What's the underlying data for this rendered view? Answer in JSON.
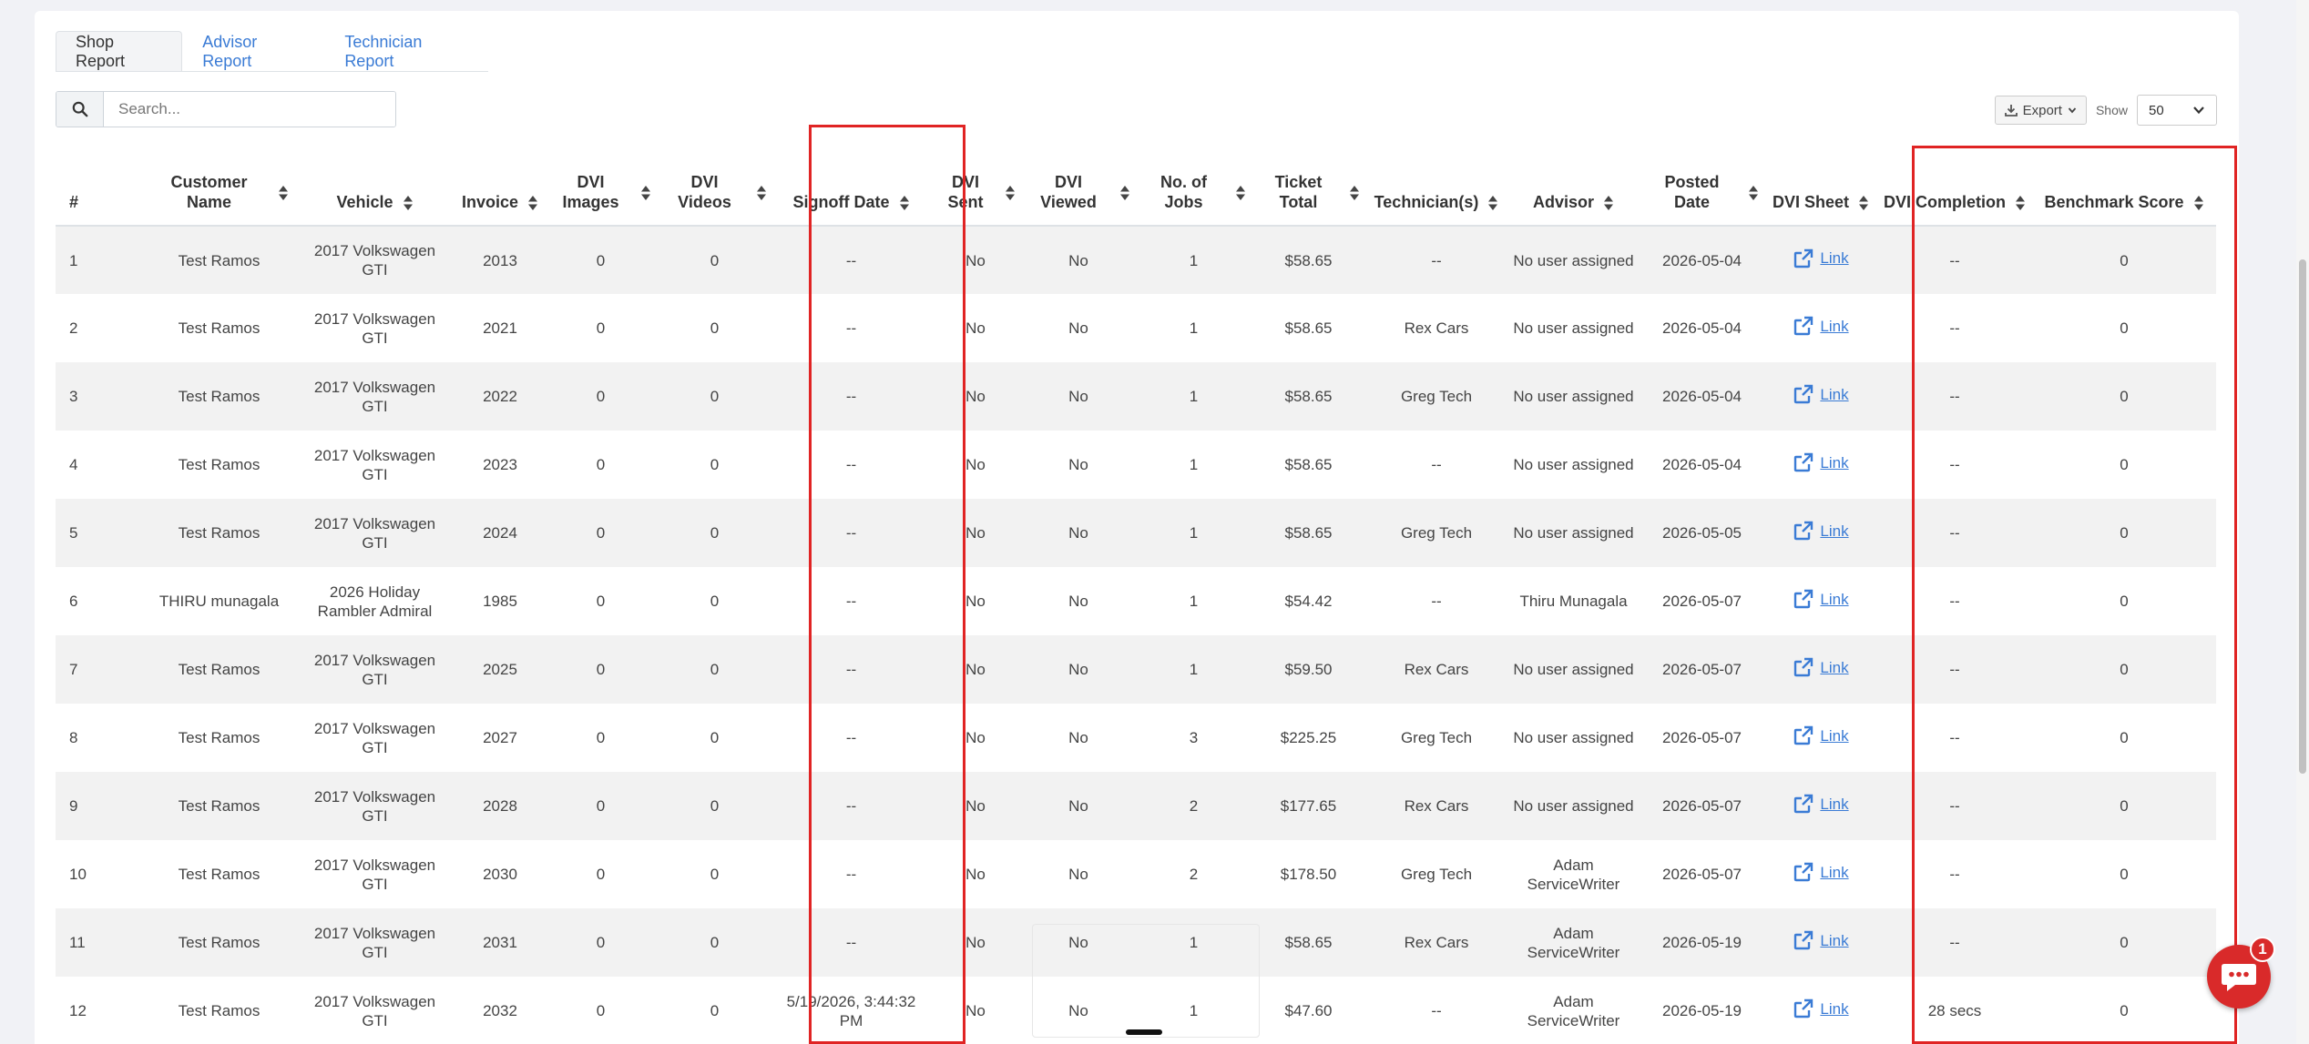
{
  "tabs": [
    {
      "label": "Shop Report",
      "active": true
    },
    {
      "label": "Advisor Report",
      "active": false
    },
    {
      "label": "Technician Report",
      "active": false
    }
  ],
  "search": {
    "placeholder": "Search...",
    "icon": "search-icon"
  },
  "export": {
    "label": "Export",
    "icon": "download-icon"
  },
  "show": {
    "label": "Show",
    "value": "50"
  },
  "table": {
    "headers": [
      "#",
      "Customer Name",
      "Vehicle",
      "Invoice",
      "DVI Images",
      "DVI Videos",
      "Signoff Date",
      "DVI Sent",
      "DVI Viewed",
      "No. of Jobs",
      "Ticket Total",
      "Technician(s)",
      "Advisor",
      "Posted Date",
      "DVI Sheet",
      "DVI Completion",
      "Benchmark Score"
    ],
    "rows": [
      [
        "1",
        "Test Ramos",
        "2017 Volkswagen GTI",
        "2013",
        "0",
        "0",
        "--",
        "No",
        "No",
        "1",
        "$58.65",
        "--",
        "No user assigned",
        "2026-05-04",
        "Link",
        "--",
        "0"
      ],
      [
        "2",
        "Test Ramos",
        "2017 Volkswagen GTI",
        "2021",
        "0",
        "0",
        "--",
        "No",
        "No",
        "1",
        "$58.65",
        "Rex Cars",
        "No user assigned",
        "2026-05-04",
        "Link",
        "--",
        "0"
      ],
      [
        "3",
        "Test Ramos",
        "2017 Volkswagen GTI",
        "2022",
        "0",
        "0",
        "--",
        "No",
        "No",
        "1",
        "$58.65",
        "Greg Tech",
        "No user assigned",
        "2026-05-04",
        "Link",
        "--",
        "0"
      ],
      [
        "4",
        "Test Ramos",
        "2017 Volkswagen GTI",
        "2023",
        "0",
        "0",
        "--",
        "No",
        "No",
        "1",
        "$58.65",
        "--",
        "No user assigned",
        "2026-05-04",
        "Link",
        "--",
        "0"
      ],
      [
        "5",
        "Test Ramos",
        "2017 Volkswagen GTI",
        "2024",
        "0",
        "0",
        "--",
        "No",
        "No",
        "1",
        "$58.65",
        "Greg Tech",
        "No user assigned",
        "2026-05-05",
        "Link",
        "--",
        "0"
      ],
      [
        "6",
        "THIRU munagala",
        "2026 Holiday Rambler Admiral",
        "1985",
        "0",
        "0",
        "--",
        "No",
        "No",
        "1",
        "$54.42",
        "--",
        "Thiru Munagala",
        "2026-05-07",
        "Link",
        "--",
        "0"
      ],
      [
        "7",
        "Test Ramos",
        "2017 Volkswagen GTI",
        "2025",
        "0",
        "0",
        "--",
        "No",
        "No",
        "1",
        "$59.50",
        "Rex Cars",
        "No user assigned",
        "2026-05-07",
        "Link",
        "--",
        "0"
      ],
      [
        "8",
        "Test Ramos",
        "2017 Volkswagen GTI",
        "2027",
        "0",
        "0",
        "--",
        "No",
        "No",
        "3",
        "$225.25",
        "Greg Tech",
        "No user assigned",
        "2026-05-07",
        "Link",
        "--",
        "0"
      ],
      [
        "9",
        "Test Ramos",
        "2017 Volkswagen GTI",
        "2028",
        "0",
        "0",
        "--",
        "No",
        "No",
        "2",
        "$177.65",
        "Rex Cars",
        "No user assigned",
        "2026-05-07",
        "Link",
        "--",
        "0"
      ],
      [
        "10",
        "Test Ramos",
        "2017 Volkswagen GTI",
        "2030",
        "0",
        "0",
        "--",
        "No",
        "No",
        "2",
        "$178.50",
        "Greg Tech",
        "Adam ServiceWriter",
        "2026-05-07",
        "Link",
        "--",
        "0"
      ],
      [
        "11",
        "Test Ramos",
        "2017 Volkswagen GTI",
        "2031",
        "0",
        "0",
        "--",
        "No",
        "No",
        "1",
        "$58.65",
        "Rex Cars",
        "Adam ServiceWriter",
        "2026-05-19",
        "Link",
        "--",
        "0"
      ],
      [
        "12",
        "Test Ramos",
        "2017 Volkswagen GTI",
        "2032",
        "0",
        "0",
        "5/19/2026, 3:44:32 PM",
        "No",
        "No",
        "1",
        "$47.60",
        "--",
        "Adam ServiceWriter",
        "2026-05-19",
        "Link",
        "28 secs",
        "0"
      ]
    ]
  },
  "chat": {
    "badge": "1",
    "icon": "chat-icon"
  },
  "colors": {
    "accent": "#3a7bd5",
    "highlight": "#e02424",
    "chat": "#d92a2a"
  }
}
